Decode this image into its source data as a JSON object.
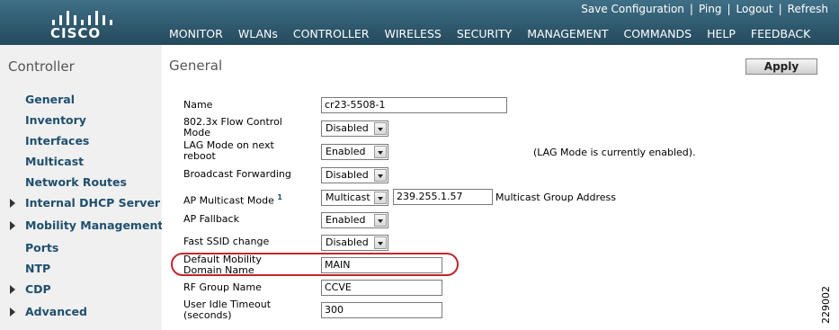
{
  "header": {
    "brand": "CISCO",
    "top_links": [
      "Save Configuration",
      "Ping",
      "Logout",
      "Refresh"
    ],
    "nav": [
      "MONITOR",
      "WLANs",
      "CONTROLLER",
      "WIRELESS",
      "SECURITY",
      "MANAGEMENT",
      "COMMANDS",
      "HELP",
      "FEEDBACK"
    ]
  },
  "sidebar": {
    "title": "Controller",
    "items": [
      {
        "label": "General",
        "expandable": false
      },
      {
        "label": "Inventory",
        "expandable": false
      },
      {
        "label": "Interfaces",
        "expandable": false
      },
      {
        "label": "Multicast",
        "expandable": false
      },
      {
        "label": "Network Routes",
        "expandable": false
      },
      {
        "label": "Internal DHCP Server",
        "expandable": true
      },
      {
        "label": "Mobility Management",
        "expandable": true
      },
      {
        "label": "Ports",
        "expandable": false
      },
      {
        "label": "NTP",
        "expandable": false
      },
      {
        "label": "CDP",
        "expandable": true
      },
      {
        "label": "Advanced",
        "expandable": true
      }
    ]
  },
  "page": {
    "title": "General",
    "apply_label": "Apply"
  },
  "form": {
    "name": {
      "label": "Name",
      "value": "cr23-5508-1"
    },
    "flow_control": {
      "label": "802.3x Flow Control Mode",
      "value": "Disabled"
    },
    "lag_mode": {
      "label": "LAG Mode on next reboot",
      "value": "Enabled",
      "note": "(LAG Mode is currently enabled)."
    },
    "broadcast": {
      "label": "Broadcast Forwarding",
      "value": "Disabled"
    },
    "ap_multicast": {
      "label": "AP Multicast Mode",
      "footnote": "1",
      "value": "Multicast",
      "address": "239.255.1.57",
      "address_label": "Multicast Group Address"
    },
    "ap_fallback": {
      "label": "AP Fallback",
      "value": "Enabled"
    },
    "fast_ssid": {
      "label": "Fast SSID change",
      "value": "Disabled"
    },
    "mobility_domain": {
      "label": "Default Mobility Domain Name",
      "value": "MAIN"
    },
    "rf_group": {
      "label": "RF Group Name",
      "value": "CCVE"
    },
    "idle_timeout": {
      "label": "User Idle Timeout (seconds)",
      "value": "300"
    }
  },
  "figure_id": "229002",
  "colors": {
    "header": "#2f5b70",
    "sidebar_bg": "#f0f0f0",
    "sidebar_link": "#1f4f6e",
    "highlight": "#c0272d"
  }
}
